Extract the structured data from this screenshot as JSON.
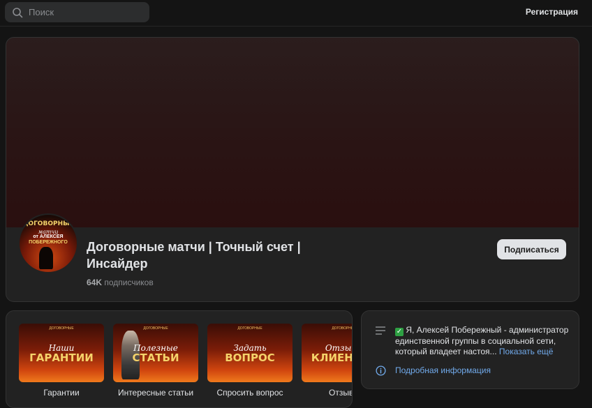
{
  "header": {
    "search_placeholder": "Поиск",
    "register_label": "Регистрация"
  },
  "group": {
    "avatar": {
      "line1": "ДОГОВОРНЫЕ",
      "line2": "матчи",
      "line3": "от АЛЕКСЕЯ",
      "line4": "ПОБЕРЕЖНОГО"
    },
    "title": "Договорные матчи | Точный счет | Инсайдер",
    "subscribers_count": "64K",
    "subscribers_label": "подписчиков",
    "subscribe_label": "Подписаться"
  },
  "links": [
    {
      "line1": "Наши",
      "line2": "ГАРАНТИИ",
      "label": "Гарантии"
    },
    {
      "line1": "Полезные",
      "line2": "СТАТЬИ",
      "label": "Интересные статьи"
    },
    {
      "line1": "Задать",
      "line2": "ВОПРОС",
      "label": "Спросить вопрос"
    },
    {
      "line1": "Отзывы",
      "line2": "КЛИЕНТОВ",
      "label": "Отзывы"
    }
  ],
  "description": {
    "check_glyph": "✓",
    "text": "Я, Алексей Побережный - администратор единственной группы в социальной сети, который владеет настоя...",
    "show_more": "Показать ещё",
    "details_link": "Подробная информация"
  },
  "colors": {
    "background": "#141414",
    "card": "#222222",
    "link": "#71aaeb",
    "accent_check": "#2ea043"
  }
}
